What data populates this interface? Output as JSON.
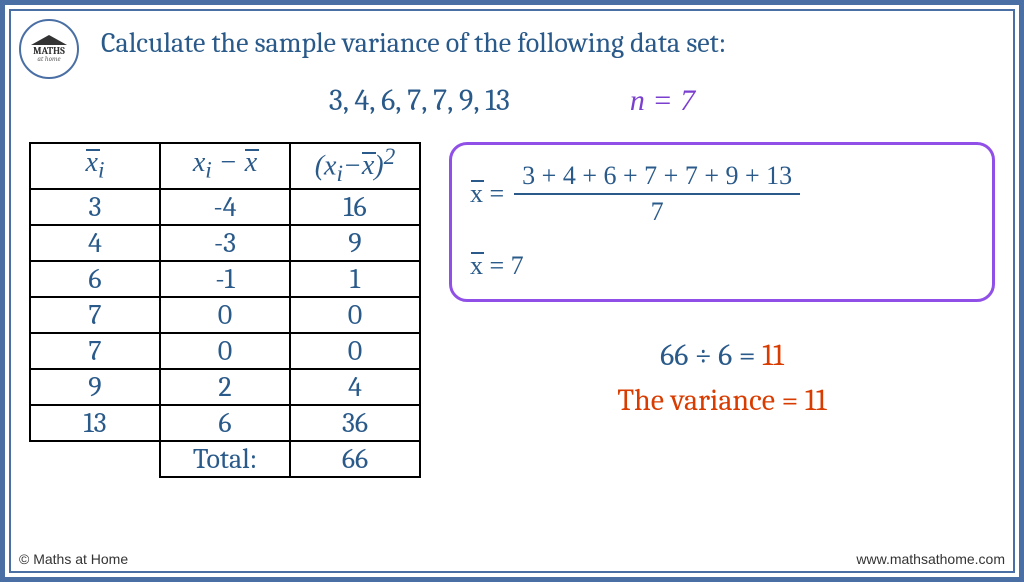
{
  "logo": {
    "line1": "MATHS",
    "line2": "at home"
  },
  "title": "Calculate the sample variance of the following data set:",
  "data_set": "3, 4, 6, 7, 7, 9, 13",
  "n_text": "n = 7",
  "table": {
    "headers": {
      "c1": "x",
      "c1sub": "i",
      "c2": "x",
      "c2sub": "i",
      "c2minus": " − ",
      "c3": "(x",
      "c3sub": "i",
      "c3minus": "−",
      "c3end": ")",
      "c3sup": "2"
    },
    "rows": [
      {
        "xi": "3",
        "diff": "-4",
        "sq": "16"
      },
      {
        "xi": "4",
        "diff": "-3",
        "sq": "9"
      },
      {
        "xi": "6",
        "diff": "-1",
        "sq": "1"
      },
      {
        "xi": "7",
        "diff": "0",
        "sq": "0"
      },
      {
        "xi": "7",
        "diff": "0",
        "sq": "0"
      },
      {
        "xi": "9",
        "diff": "2",
        "sq": "4"
      },
      {
        "xi": "13",
        "diff": "6",
        "sq": "36"
      }
    ],
    "total_label": "Total:",
    "total_value": "66"
  },
  "mean_box": {
    "lhs": "x̄ =",
    "numerator": "3 + 4 + 6 + 7 + 7 + 9 + 13",
    "denominator": "7",
    "result": "x̄ = 7"
  },
  "division": {
    "left": "66 ÷ 6 = ",
    "right": "11"
  },
  "variance": "The variance = 11",
  "footer": {
    "left": "© Maths at Home",
    "right": "www.mathsathome.com"
  },
  "chart_data": {
    "type": "table",
    "title": "Sample variance calculation",
    "data_values": [
      3,
      4,
      6,
      7,
      7,
      9,
      13
    ],
    "n": 7,
    "mean": 7,
    "deviations": [
      -4,
      -3,
      -1,
      0,
      0,
      2,
      6
    ],
    "squared_deviations": [
      16,
      9,
      1,
      0,
      0,
      4,
      36
    ],
    "sum_squared_deviations": 66,
    "divisor": 6,
    "sample_variance": 11
  }
}
